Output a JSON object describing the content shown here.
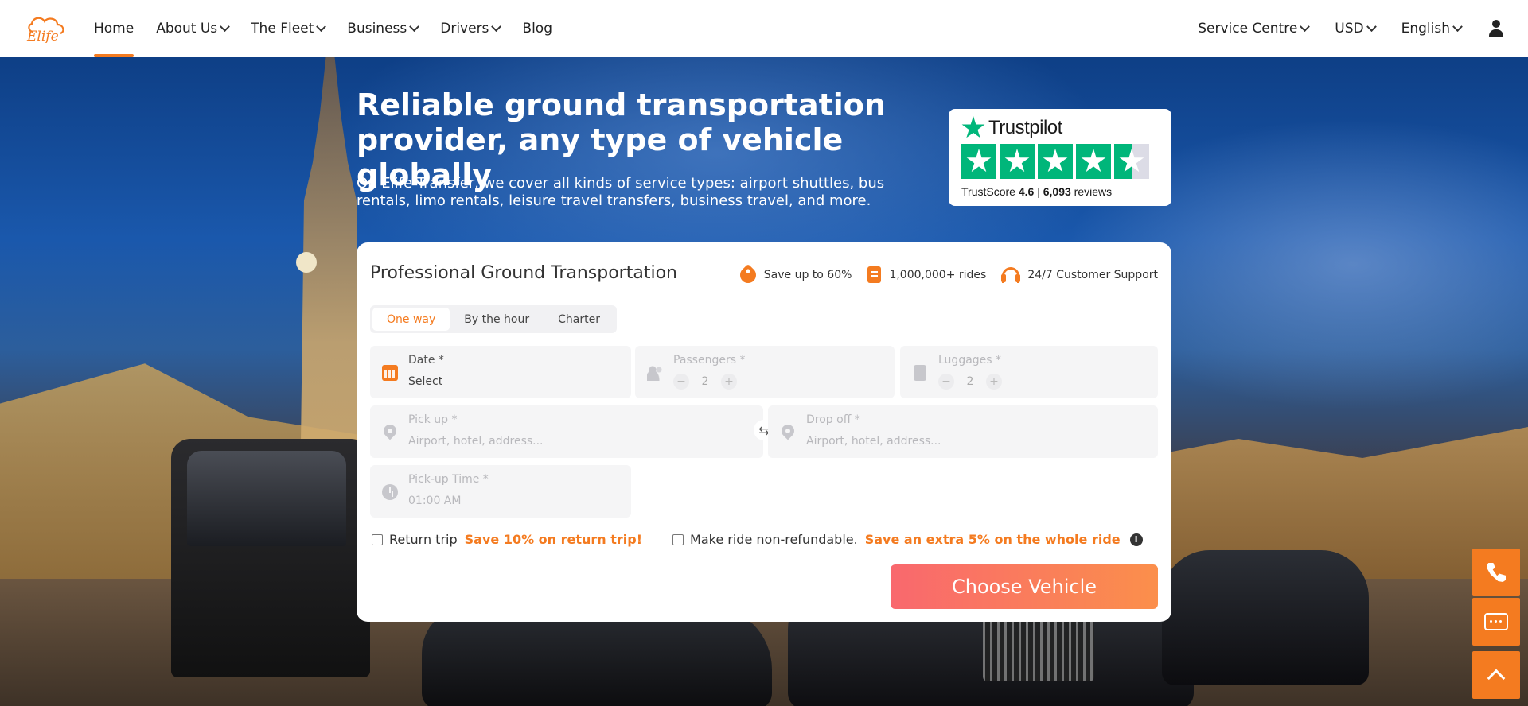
{
  "brand": {
    "logo_text": "Elife",
    "accent": "#f47b20"
  },
  "nav": {
    "items": [
      {
        "label": "Home",
        "active": true,
        "dropdown": false
      },
      {
        "label": "About Us",
        "dropdown": true
      },
      {
        "label": "The Fleet",
        "dropdown": true
      },
      {
        "label": "Business",
        "dropdown": true
      },
      {
        "label": "Drivers",
        "dropdown": true
      },
      {
        "label": "Blog",
        "dropdown": false
      }
    ],
    "right": [
      {
        "label": "Service Centre",
        "dropdown": true
      },
      {
        "label": "USD",
        "dropdown": true
      },
      {
        "label": "English",
        "dropdown": true
      }
    ],
    "user_icon": "user-icon"
  },
  "hero": {
    "title": "Reliable ground transportation provider, any type of vehicle globally",
    "subtitle": "On Elife Transfer, we cover all kinds of service types: airport shuttles, bus rentals, limo rentals, leisure travel transfers, business travel, and more."
  },
  "trustpilot": {
    "name": "Trustpilot",
    "score_label": "TrustScore",
    "score": "4.6",
    "separator": "|",
    "reviews_count": "6,093",
    "reviews_label": "reviews",
    "stars": 4.5,
    "color": "#00b67a"
  },
  "booking": {
    "title": "Professional Ground Transportation",
    "features": [
      {
        "icon": "tag-icon",
        "label": "Save up to 60%"
      },
      {
        "icon": "document-icon",
        "label": "1,000,000+ rides"
      },
      {
        "icon": "headset-icon",
        "label": "24/7 Customer Support"
      }
    ],
    "tabs": [
      {
        "label": "One way",
        "active": true
      },
      {
        "label": "By the hour"
      },
      {
        "label": "Charter"
      }
    ],
    "date": {
      "label": "Date *",
      "value": "Select"
    },
    "passengers": {
      "label": "Passengers *",
      "value": "2",
      "minus": "−",
      "plus": "+"
    },
    "luggages": {
      "label": "Luggages *",
      "value": "2",
      "minus": "−",
      "plus": "+"
    },
    "pickup": {
      "label": "Pick up *",
      "placeholder": "Airport, hotel, address..."
    },
    "dropoff": {
      "label": "Drop off *",
      "placeholder": "Airport, hotel, address..."
    },
    "swap_glyph": "⇆",
    "pickup_time": {
      "label": "Pick-up Time *",
      "value": "01:00 AM"
    },
    "return_trip": {
      "label": "Return trip",
      "promo": "Save 10% on return trip!",
      "checked": false
    },
    "non_refundable": {
      "label": "Make ride non-refundable.",
      "promo": "Save an extra 5% on the whole ride",
      "info": "i",
      "checked": false
    },
    "cta": "Choose Vehicle",
    "cta_colors": [
      "#f9686e",
      "#fb8f4b"
    ]
  },
  "floating": [
    "phone-icon",
    "chat-icon",
    "arrow-up-icon"
  ]
}
